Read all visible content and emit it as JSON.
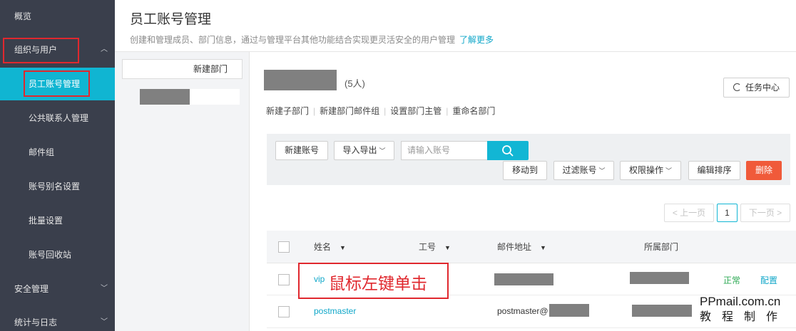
{
  "sidebar": {
    "items": [
      {
        "label": "概览"
      },
      {
        "label": "组织与用户"
      },
      {
        "label": "员工账号管理"
      },
      {
        "label": "公共联系人管理"
      },
      {
        "label": "邮件组"
      },
      {
        "label": "账号别名设置"
      },
      {
        "label": "批量设置"
      },
      {
        "label": "账号回收站"
      },
      {
        "label": "安全管理"
      },
      {
        "label": "统计与日志"
      }
    ],
    "chevron_up": "︿",
    "chevron_down": "﹀"
  },
  "header": {
    "title": "员工账号管理",
    "description": "创建和管理成员、部门信息，通过与管理平台其他功能结合实现更灵活安全的用户管理",
    "learn_more": "了解更多"
  },
  "dept_panel": {
    "new_dept": "新建部门"
  },
  "main": {
    "member_count": "(5人)",
    "task_center": "任务中心",
    "dept_actions": [
      "新建子部门",
      "新建部门邮件组",
      "设置部门主管",
      "重命名部门"
    ],
    "toolbar": {
      "new_account": "新建账号",
      "import_export": "导入导出",
      "search_placeholder": "请输入账号",
      "move_to": "移动到",
      "filter_accounts": "过滤账号",
      "permission_ops": "权限操作",
      "edit_sort": "编辑排序",
      "delete": "删除"
    },
    "pagination": {
      "prev": "< 上一页",
      "current": "1",
      "next": "下一页 >"
    },
    "table": {
      "headers": [
        "姓名",
        "工号",
        "邮件地址",
        "所属部门"
      ],
      "rows": [
        {
          "name": "vip",
          "email_prefix": "",
          "status": "正常",
          "action": "配置"
        },
        {
          "name": "postmaster",
          "email_prefix": "postmaster@",
          "status": "",
          "action": ""
        }
      ]
    }
  },
  "annotation": {
    "text": "鼠标左键单击"
  },
  "watermark": {
    "line1": "PPmail.com.cn",
    "line2": "教程制作"
  },
  "colors": {
    "accent": "#10b5d2",
    "sidebar_bg": "#3a3f4c",
    "annotation_red": "#e0282e",
    "delete_btn": "#f05a3a",
    "status_ok": "#2eaa55"
  }
}
